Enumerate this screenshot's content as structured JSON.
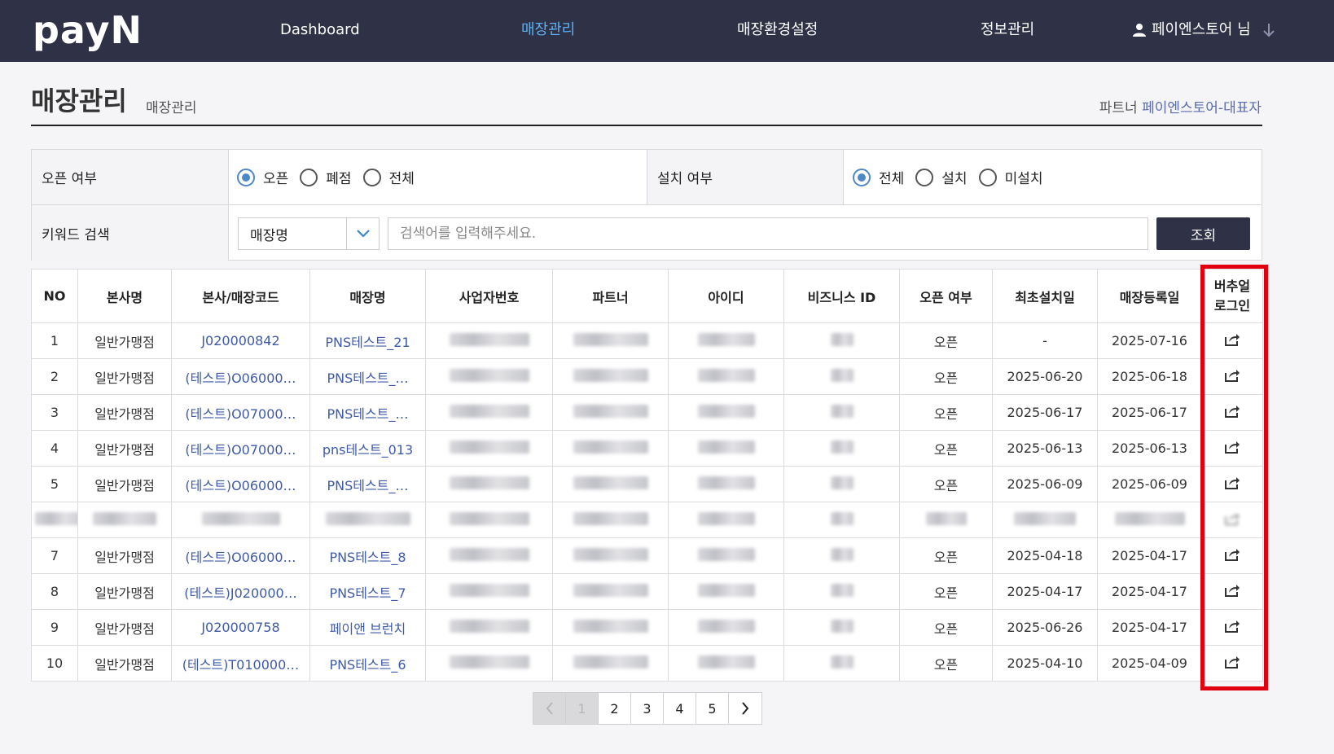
{
  "header": {
    "logo": "payN",
    "nav": [
      {
        "label": "Dashboard",
        "active": false
      },
      {
        "label": "매장관리",
        "active": true
      },
      {
        "label": "매장환경설정",
        "active": false
      },
      {
        "label": "정보관리",
        "active": false
      }
    ],
    "user": "페이엔스토어 님",
    "user_icon": "user-icon",
    "user_arrow_icon": "arrow-down-icon",
    "colors": {
      "bar": "#2f3147",
      "active": "#5fb0f0"
    }
  },
  "page": {
    "title": "매장관리",
    "breadcrumb": "매장관리",
    "partner_prefix": "파트너",
    "partner_name": "페이엔스토어-대표자"
  },
  "filters": {
    "open_label": "오픈 여부",
    "open_options": [
      {
        "label": "오픈",
        "checked": true
      },
      {
        "label": "폐점",
        "checked": false
      },
      {
        "label": "전체",
        "checked": false
      }
    ],
    "install_label": "설치 여부",
    "install_options": [
      {
        "label": "전체",
        "checked": true
      },
      {
        "label": "설치",
        "checked": false
      },
      {
        "label": "미설치",
        "checked": false
      }
    ],
    "keyword_label": "키워드 검색",
    "select_value": "매장명",
    "search_placeholder": "검색어를 입력해주세요.",
    "search_button": "조회"
  },
  "table": {
    "headers": [
      "NO",
      "본사명",
      "본사/매장코드",
      "매장명",
      "사업자번호",
      "파트너",
      "아이디",
      "비즈니스 ID",
      "오픈 여부",
      "최초설치일",
      "매장등록일",
      "버추얼 로그인"
    ],
    "virtual_login_head_line1": "버추얼",
    "virtual_login_head_line2": "로그인",
    "virtual_login_icon": "share-external-icon",
    "rows": [
      {
        "no": "1",
        "hq": "일반가맹점",
        "code": "J020000842",
        "store": "PNS테스트_21",
        "status": "오픈",
        "first_install": "-",
        "registered": "2025-07-16",
        "blurred": false
      },
      {
        "no": "2",
        "hq": "일반가맹점",
        "code": "(테스트)O06000…",
        "store": "PNS테스트_…",
        "status": "오픈",
        "first_install": "2025-06-20",
        "registered": "2025-06-18",
        "blurred": false
      },
      {
        "no": "3",
        "hq": "일반가맹점",
        "code": "(테스트)O07000…",
        "store": "PNS테스트_…",
        "status": "오픈",
        "first_install": "2025-06-17",
        "registered": "2025-06-17",
        "blurred": false
      },
      {
        "no": "4",
        "hq": "일반가맹점",
        "code": "(테스트)O07000…",
        "store": "pns테스트_013",
        "status": "오픈",
        "first_install": "2025-06-13",
        "registered": "2025-06-13",
        "blurred": false
      },
      {
        "no": "5",
        "hq": "일반가맹점",
        "code": "(테스트)O06000…",
        "store": "PNS테스트_…",
        "status": "오픈",
        "first_install": "2025-06-09",
        "registered": "2025-06-09",
        "blurred": false
      },
      {
        "no": "",
        "hq": "",
        "code": "",
        "store": "",
        "status": "",
        "first_install": "",
        "registered": "",
        "blurred": true
      },
      {
        "no": "7",
        "hq": "일반가맹점",
        "code": "(테스트)O06000…",
        "store": "PNS테스트_8",
        "status": "오픈",
        "first_install": "2025-04-18",
        "registered": "2025-04-17",
        "blurred": false
      },
      {
        "no": "8",
        "hq": "일반가맹점",
        "code": "(테스트)J020000…",
        "store": "PNS테스트_7",
        "status": "오픈",
        "first_install": "2025-04-17",
        "registered": "2025-04-17",
        "blurred": false
      },
      {
        "no": "9",
        "hq": "일반가맹점",
        "code": "J020000758",
        "store": "페이앤 브런치",
        "status": "오픈",
        "first_install": "2025-06-26",
        "registered": "2025-04-17",
        "blurred": false
      },
      {
        "no": "10",
        "hq": "일반가맹점",
        "code": "(테스트)T010000…",
        "store": "PNS테스트_6",
        "status": "오픈",
        "first_install": "2025-04-10",
        "registered": "2025-04-09",
        "blurred": false
      }
    ]
  },
  "pagination": {
    "prev_icon": "chevron-left-icon",
    "next_icon": "chevron-right-icon",
    "pages": [
      "1",
      "2",
      "3",
      "4",
      "5"
    ],
    "current": "1"
  },
  "highlight_color": "#e00010"
}
